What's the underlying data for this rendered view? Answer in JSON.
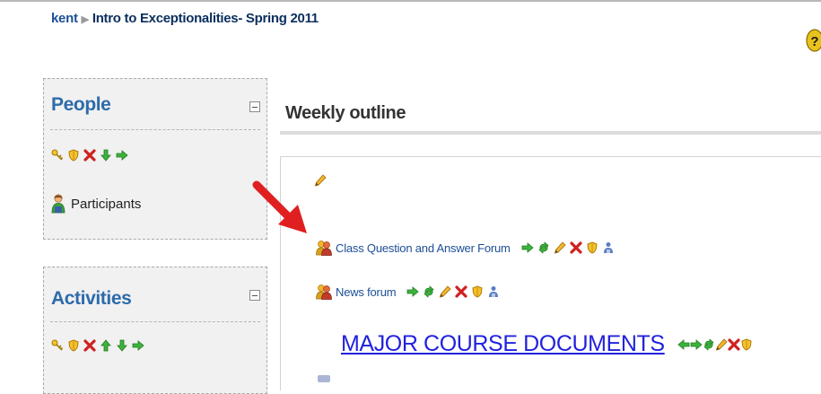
{
  "breadcrumb": {
    "home": "kent",
    "current": "Intro to Exceptionalities- Spring 2011"
  },
  "blocks": {
    "people": {
      "title": "People",
      "controls": [
        "key-icon",
        "shield-icon",
        "delete-icon",
        "move-down-icon",
        "move-right-icon"
      ],
      "link": "Participants"
    },
    "activities": {
      "title": "Activities",
      "controls": [
        "key-icon",
        "shield-icon",
        "delete-icon",
        "move-up-icon",
        "move-down-icon",
        "move-right-icon"
      ]
    }
  },
  "main": {
    "section_title": "Weekly outline",
    "activities": [
      {
        "label": "Class Question and Answer Forum",
        "controls": [
          "move-right-icon",
          "duplicate-icon",
          "edit-icon",
          "delete-icon",
          "shield-icon",
          "group-icon"
        ]
      },
      {
        "label": "News forum",
        "controls": [
          "move-right-icon",
          "duplicate-icon",
          "edit-icon",
          "delete-icon",
          "shield-icon",
          "group-icon"
        ]
      }
    ],
    "label_item": {
      "label": "MAJOR COURSE DOCUMENTS",
      "controls": [
        "move-left-icon",
        "move-right-icon",
        "duplicate-icon",
        "edit-icon",
        "delete-icon",
        "shield-icon"
      ]
    }
  },
  "colors": {
    "link": "#1d4f97",
    "block_title": "#2d6baa",
    "major_label": "#2222dd",
    "annotation_arrow": "#e02020"
  }
}
